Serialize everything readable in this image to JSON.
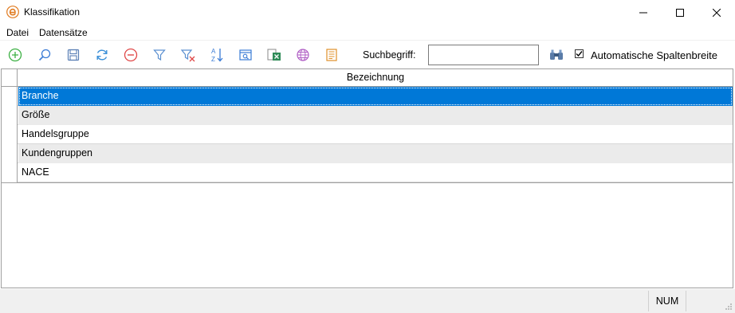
{
  "window": {
    "title": "Klassifikation",
    "app_icon": "e-logo-icon",
    "controls": [
      "minimize-icon",
      "maximize-icon",
      "close-icon"
    ]
  },
  "menu": {
    "items": [
      {
        "label": "Datei"
      },
      {
        "label": "Datensätze"
      }
    ]
  },
  "toolbar": {
    "buttons": [
      {
        "icon": "add-icon",
        "color": "#3cb043"
      },
      {
        "icon": "search-icon",
        "color": "#3a7bd5"
      },
      {
        "icon": "save-icon",
        "color": "#5a7fb5"
      },
      {
        "icon": "refresh-icon",
        "color": "#3a8fd8"
      },
      {
        "icon": "delete-icon",
        "color": "#e04848"
      },
      {
        "icon": "filter-icon",
        "color": "#5a8fd0"
      },
      {
        "icon": "clear-filter-icon",
        "color": "#5a8fd0"
      },
      {
        "icon": "sort-az-icon",
        "color": "#3a7bd5"
      },
      {
        "icon": "form-view-icon",
        "color": "#3a7bd5"
      },
      {
        "icon": "excel-export-icon",
        "color": "#2e8b57"
      },
      {
        "icon": "web-icon",
        "color": "#b05fc5"
      },
      {
        "icon": "report-icon",
        "color": "#e0902a"
      }
    ],
    "search_label": "Suchbegriff:",
    "search_value": "",
    "find_icon": "binoculars-icon",
    "auto_width_checked": true,
    "auto_width_label": "Automatische Spaltenbreite"
  },
  "grid": {
    "column_header": "Bezeichnung",
    "rows": [
      "Branche",
      "Größe",
      "Handelsgruppe",
      "Kundengruppen",
      "NACE"
    ],
    "selected_index": 0,
    "selection_color": "#0078d7"
  },
  "status": {
    "num": "NUM"
  }
}
